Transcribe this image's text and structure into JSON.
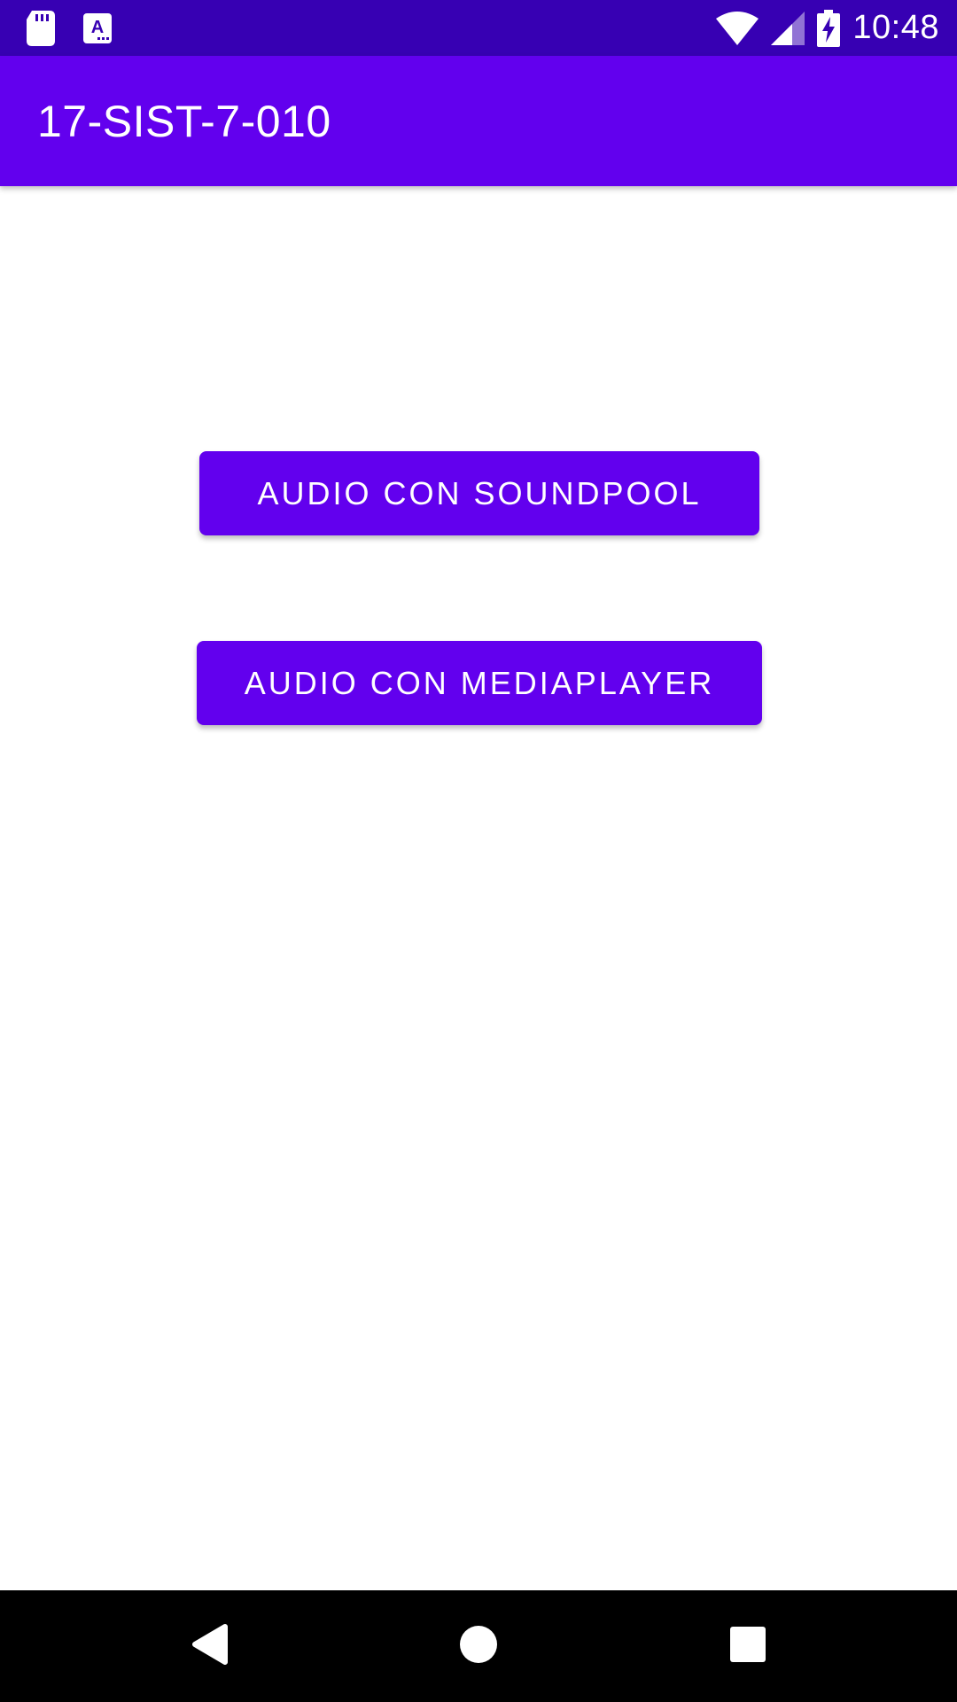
{
  "status_bar": {
    "time": "10:48",
    "icons": [
      "sd-card-icon",
      "text-a-icon",
      "wifi-icon",
      "cell-signal-icon",
      "battery-charging-icon"
    ]
  },
  "app_bar": {
    "title": "17-SIST-7-010"
  },
  "main": {
    "buttons": [
      {
        "label": "AUDIO CON SOUNDPOOL"
      },
      {
        "label": "AUDIO CON MEDIAPLAYER"
      }
    ]
  },
  "nav_bar": {
    "icons": [
      "back-icon",
      "home-icon",
      "recents-icon"
    ]
  },
  "colors": {
    "status_bar": "#3700b3",
    "primary": "#6200ee",
    "background": "#ffffff",
    "nav_bar": "#000000"
  }
}
